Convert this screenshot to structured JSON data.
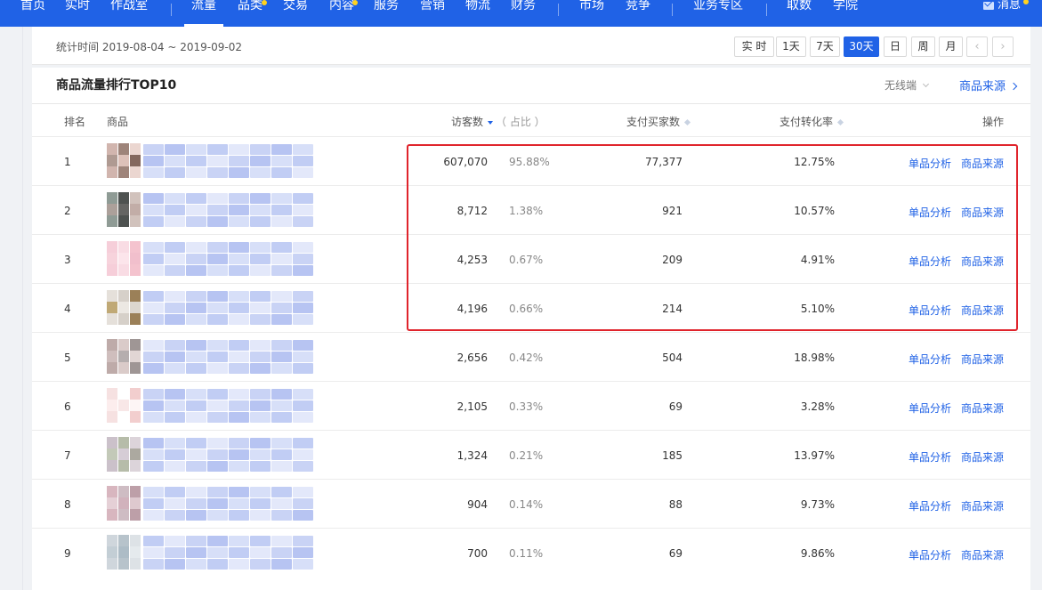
{
  "nav": {
    "items": [
      "首页",
      "实时",
      "作战室",
      "流量",
      "品类",
      "交易",
      "内容",
      "服务",
      "营销",
      "物流",
      "财务",
      "市场",
      "竞争",
      "业务专区",
      "取数",
      "学院"
    ],
    "active_index": 3,
    "messages_label": "消息"
  },
  "toolbar": {
    "stat_time": "统计时间 2019-08-04 ~ 2019-09-02",
    "time_ranges": [
      "实 时",
      "1天",
      "7天",
      "30天",
      "日",
      "周",
      "月"
    ],
    "active_range_index": 3,
    "prev_glyph": "‹",
    "next_glyph": "›"
  },
  "section": {
    "title": "商品流量排行TOP10",
    "device_select": "无线端",
    "source_link": "商品来源"
  },
  "table": {
    "headers": {
      "rank": "排名",
      "product": "商品",
      "visitors": "访客数",
      "share": "（ 占比 ）",
      "buyers": "支付买家数",
      "conversion": "支付转化率",
      "actions": "操作"
    },
    "action_labels": {
      "analysis": "单品分析",
      "source": "商品来源"
    },
    "rows": [
      {
        "rank": "1",
        "visitors": "607,070",
        "share": "95.88%",
        "buyers": "77,377",
        "conversion": "12.75%"
      },
      {
        "rank": "2",
        "visitors": "8,712",
        "share": "1.38%",
        "buyers": "921",
        "conversion": "10.57%"
      },
      {
        "rank": "3",
        "visitors": "4,253",
        "share": "0.67%",
        "buyers": "209",
        "conversion": "4.91%"
      },
      {
        "rank": "4",
        "visitors": "4,196",
        "share": "0.66%",
        "buyers": "214",
        "conversion": "5.10%"
      },
      {
        "rank": "5",
        "visitors": "2,656",
        "share": "0.42%",
        "buyers": "504",
        "conversion": "18.98%"
      },
      {
        "rank": "6",
        "visitors": "2,105",
        "share": "0.33%",
        "buyers": "69",
        "conversion": "3.28%"
      },
      {
        "rank": "7",
        "visitors": "1,324",
        "share": "0.21%",
        "buyers": "185",
        "conversion": "13.97%"
      },
      {
        "rank": "8",
        "visitors": "904",
        "share": "0.14%",
        "buyers": "88",
        "conversion": "9.73%"
      },
      {
        "rank": "9",
        "visitors": "700",
        "share": "0.11%",
        "buyers": "69",
        "conversion": "9.86%"
      }
    ]
  },
  "colors": {
    "brand": "#2062e6",
    "highlight": "#e0242c",
    "nav_badge": "#ffd21f"
  },
  "icons": {
    "mail": "mail-icon",
    "device_dropdown": "chevron-down-icon",
    "source_arrow": "chevron-right-icon",
    "sort_active": "sort-desc-icon",
    "sort_inactive": "sort-icon"
  }
}
